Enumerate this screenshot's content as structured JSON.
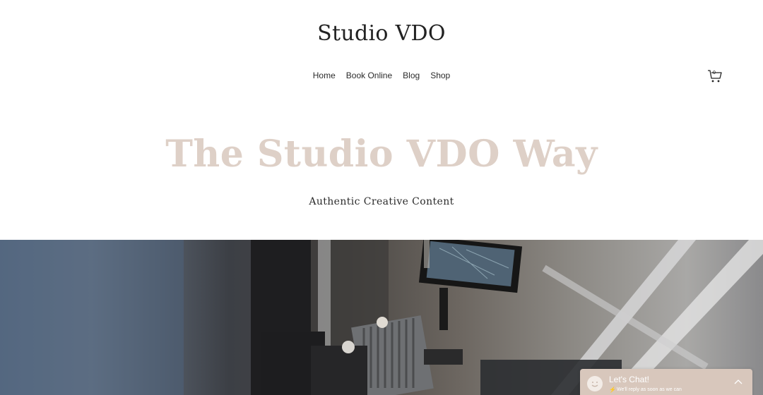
{
  "header": {
    "site_title": "Studio VDO",
    "nav": [
      "Home",
      "Book Online",
      "Blog",
      "Shop"
    ],
    "cart_count": "0"
  },
  "hero": {
    "title": "The Studio VDO Way",
    "subtitle": "Authentic Creative Content"
  },
  "chat": {
    "title": "Let's Chat!",
    "subtitle": "We'll reply as soon as we can"
  },
  "icons": {
    "cart": "cart-icon",
    "chat_avatar": "smiley-icon",
    "chat_expand": "chevron-up-icon",
    "chat_bolt": "lightning-icon"
  },
  "colors": {
    "hero_title": "#ded0c7",
    "chat_bg": "#d8c7bc"
  }
}
